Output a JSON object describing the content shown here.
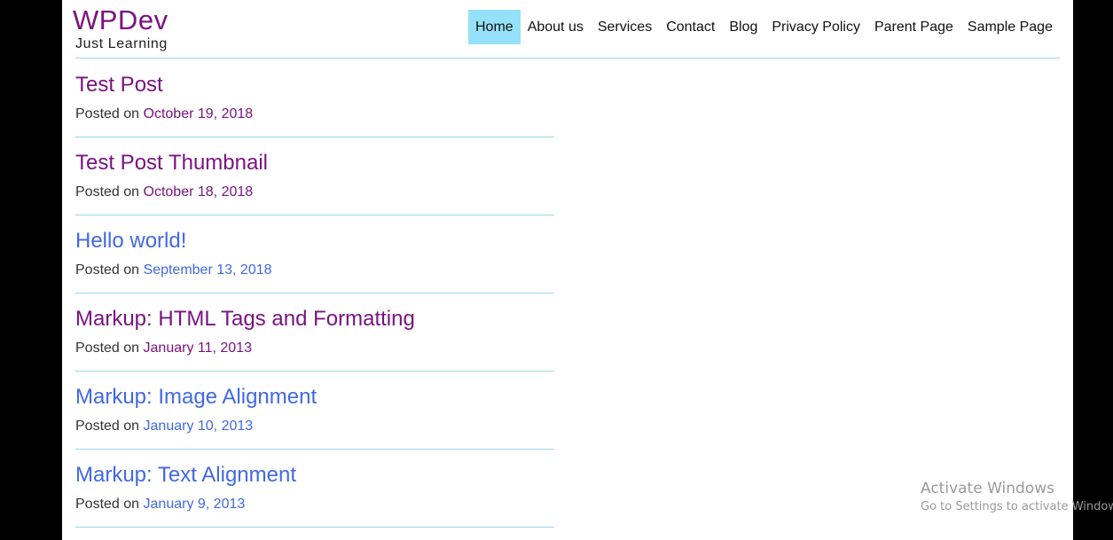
{
  "site": {
    "title": "WPDev",
    "tagline": "Just Learning"
  },
  "nav": {
    "items": [
      {
        "label": "Home",
        "active": true
      },
      {
        "label": "About us",
        "active": false
      },
      {
        "label": "Services",
        "active": false
      },
      {
        "label": "Contact",
        "active": false
      },
      {
        "label": "Blog",
        "active": false
      },
      {
        "label": "Privacy Policy",
        "active": false
      },
      {
        "label": "Parent Page",
        "active": false
      },
      {
        "label": "Sample Page",
        "active": false
      }
    ]
  },
  "posts": [
    {
      "title": "Test Post",
      "posted_on": "Posted on",
      "date": "October 19, 2018",
      "link_color": "#7a1382"
    },
    {
      "title": "Test Post Thumbnail",
      "posted_on": "Posted on",
      "date": "October 18, 2018",
      "link_color": "#7a1382"
    },
    {
      "title": "Hello world!",
      "posted_on": "Posted on",
      "date": "September 13, 2018",
      "link_color": "#4169e1"
    },
    {
      "title": "Markup: HTML Tags and Formatting",
      "posted_on": "Posted on",
      "date": "January 11, 2013",
      "link_color": "#7a1382"
    },
    {
      "title": "Markup: Image Alignment",
      "posted_on": "Posted on",
      "date": "January 10, 2013",
      "link_color": "#4169e1"
    },
    {
      "title": "Markup: Text Alignment",
      "posted_on": "Posted on",
      "date": "January 9, 2013",
      "link_color": "#4169e1"
    }
  ],
  "watermark": {
    "title": "Activate Windows",
    "subtitle": "Go to Settings to activate Windows."
  },
  "colors": {
    "visited_link": "#7a1382",
    "link": "#4169e1",
    "nav_active_bg": "#95e1f9",
    "rule": "#98d9e8"
  }
}
